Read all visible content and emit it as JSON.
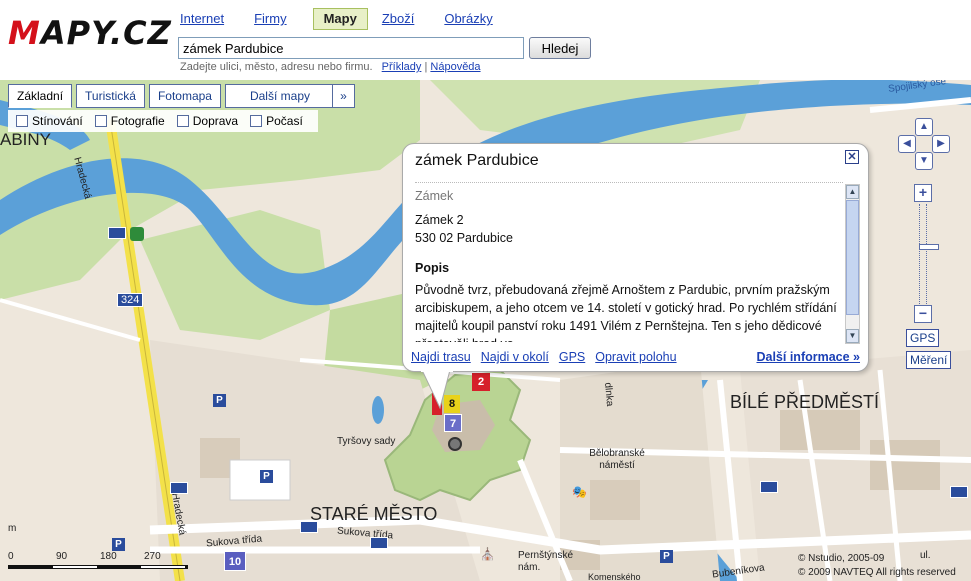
{
  "header": {
    "logo_text": "MAPY.CZ",
    "nav": [
      {
        "label": "Internet"
      },
      {
        "label": "Firmy"
      },
      {
        "label": "Mapy",
        "active": true
      },
      {
        "label": "Zboží"
      },
      {
        "label": "Obrázky"
      }
    ],
    "search_value": "zámek Pardubice",
    "search_button": "Hledej",
    "hint_text": "Zadejte ulici, město, adresu nebo firmu.",
    "hint_examples": "Příklady",
    "hint_help": "Nápověda"
  },
  "map_types": {
    "basic": "Základní",
    "tourist": "Turistická",
    "photo": "Fotomapa",
    "more": "Další mapy",
    "more_icon": "chevron-double-down"
  },
  "layers": {
    "shading": "Stínování",
    "photos": "Fotografie",
    "traffic": "Doprava",
    "weather": "Počasí"
  },
  "controls": {
    "gps": "GPS",
    "measure": "Měření"
  },
  "popup": {
    "title": "zámek Pardubice",
    "type": "Zámek",
    "address_line1": "Zámek 2",
    "address_line2": "530 02 Pardubice",
    "section_heading": "Popis",
    "description": "Původně tvrz, přebudovaná zřejmě Arnoštem z Pardubic, prvním pražským arcibiskupem, a jeho otcem ve 14. století v gotický hrad. Po rychlém střídání majitelů koupil panství roku 1491 Vilém z Pernštejna. Ten s jeho dědicové přestavěli hrad ve",
    "links": [
      "Najdi trasu",
      "Najdi v okolí",
      "GPS",
      "Opravit polohu"
    ],
    "more": "Další informace »"
  },
  "map_labels": {
    "district_left": "ABINY",
    "district_right": "BÍLÉ PŘEDMĚSTÍ",
    "old_town": "STARÉ MĚSTO",
    "street_hradecka": "Hradecká",
    "street_hradecka2": "Hradecká",
    "road_number": "324",
    "park": "Tyršovy sady",
    "square": "Bělobranské náměstí",
    "street_sukova": "Sukova třída",
    "street_sukova2": "Sukova třída",
    "street_spojilsky": "Spojilský ose",
    "street_pernstynske": "Pernštýnské nám.",
    "street_komenskeho": "Komenského",
    "street_bubenikova": "Bubeníkova",
    "street_kladno": "dlnka",
    "street_ul": "ul."
  },
  "markers": [
    {
      "label": "2",
      "color": "#d6202a"
    },
    {
      "label": "8",
      "color": "#e8d21a"
    },
    {
      "label": "7",
      "color": "#6a6ec8"
    },
    {
      "label": "10",
      "color": "#5a5ec0"
    }
  ],
  "scale": {
    "ticks": [
      "0",
      "90",
      "180",
      "270"
    ],
    "unit": "m"
  },
  "copyright": {
    "line1": "© Nstudio, 2005-09",
    "line2": "© 2009 NAVTEQ All rights reserved"
  }
}
